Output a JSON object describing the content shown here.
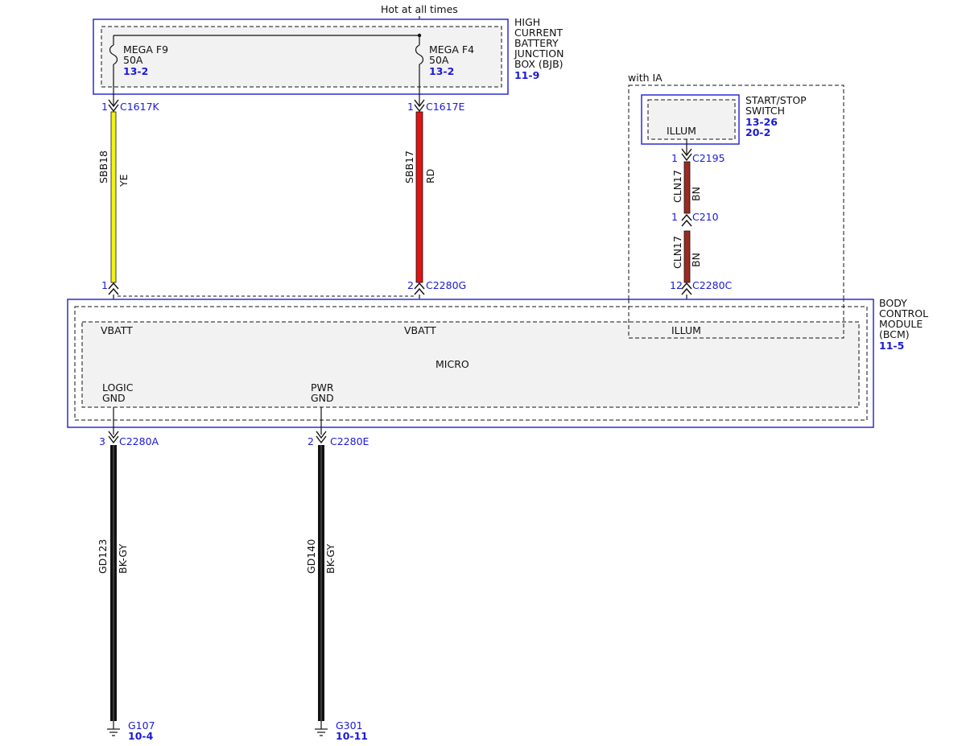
{
  "header": {
    "hot_at_all_times": "Hot at all times"
  },
  "bjb": {
    "title": [
      "HIGH",
      "CURRENT",
      "BATTERY",
      "JUNCTION",
      "BOX (BJB)"
    ],
    "ref": "11-9",
    "fuse_f9": {
      "name": "MEGA F9",
      "rating": "50A",
      "ref": "13-2"
    },
    "fuse_f4": {
      "name": "MEGA F4",
      "rating": "50A",
      "ref": "13-2"
    }
  },
  "wires": {
    "sbb18": {
      "pin_top": "1",
      "conn_top": "C1617K",
      "circuit": "SBB18",
      "color_code": "YE",
      "color": "#f3f312",
      "pin_bottom": "1"
    },
    "sbb17": {
      "pin_top": "1",
      "conn_top": "C1617E",
      "circuit": "SBB17",
      "color_code": "RD",
      "color": "#e01414",
      "pin_bottom": "2",
      "conn_bottom": "C2280G"
    },
    "cln17_upper": {
      "pin_top": "1",
      "conn_top": "C2195",
      "circuit": "CLN17",
      "color_code": "BN",
      "color": "#9b2a22"
    },
    "cln17_lower": {
      "pin_top": "1",
      "conn_top": "C210",
      "circuit": "CLN17",
      "color_code": "BN",
      "color": "#9b2a22",
      "pin_bottom": "12",
      "conn_bottom": "C2280C"
    },
    "gd123": {
      "pin_top": "3",
      "conn_top": "C2280A",
      "circuit": "GD123",
      "color_code": "BK-GY",
      "color": "#111111"
    },
    "gd140": {
      "pin_top": "2",
      "conn_top": "C2280E",
      "circuit": "GD140",
      "color_code": "BK-GY",
      "color": "#111111"
    }
  },
  "with_ia": {
    "label": "with IA"
  },
  "switch": {
    "title": [
      "START/STOP",
      "SWITCH"
    ],
    "refs": [
      "13-26",
      "20-2"
    ],
    "pin_label": "ILLUM"
  },
  "bcm": {
    "title": [
      "BODY",
      "CONTROL",
      "MODULE",
      "(BCM)"
    ],
    "ref": "11-5",
    "vbatt_1": "VBATT",
    "vbatt_2": "VBATT",
    "illum": "ILLUM",
    "micro": "MICRO",
    "logic_gnd": [
      "LOGIC",
      "GND"
    ],
    "pwr_gnd": [
      "PWR",
      "GND"
    ]
  },
  "grounds": {
    "g107": {
      "name": "G107",
      "ref": "10-4"
    },
    "g301": {
      "name": "G301",
      "ref": "10-11"
    }
  }
}
